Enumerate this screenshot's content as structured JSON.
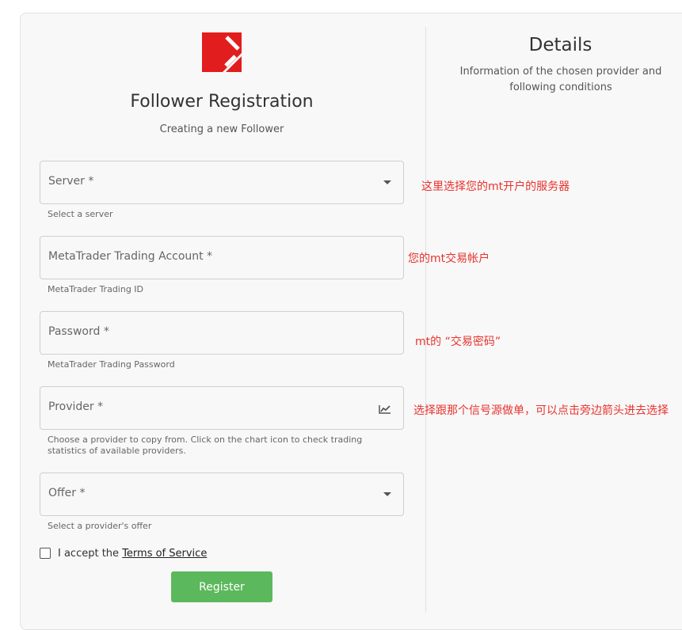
{
  "form": {
    "title": "Follower Registration",
    "subtitle": "Creating a new Follower",
    "fields": [
      {
        "label": "Server *",
        "hint": "Select a server"
      },
      {
        "label": "MetaTrader Trading Account *",
        "hint": "MetaTrader Trading ID"
      },
      {
        "label": "Password *",
        "hint": "MetaTrader Trading Password"
      },
      {
        "label": "Provider *",
        "hint": "Choose a provider to copy from. Click on the chart icon to check trading statistics of available providers."
      },
      {
        "label": "Offer *",
        "hint": "Select a provider's offer"
      }
    ],
    "accept_prefix": "I accept the ",
    "terms_link": "Terms of Service",
    "register_label": "Register"
  },
  "details": {
    "title": "Details",
    "description": "Information of the chosen provider and following conditions"
  },
  "annotations": {
    "server": "这里选择您的mt开户的服务器",
    "account": "您的mt交易帐户",
    "password": "mt的 “交易密码”",
    "provider": "选择跟那个信号源做单，可以点击旁边箭头进去选择"
  },
  "colors": {
    "accent_green": "#5cb85c",
    "logo_red": "#e21d1d",
    "annotation_red": "#e8332e"
  },
  "icons": {
    "logo": "brand-logo-icon",
    "dropdown": "chevron-down-icon",
    "chart": "chart-icon",
    "checkbox": "checkbox-icon"
  }
}
